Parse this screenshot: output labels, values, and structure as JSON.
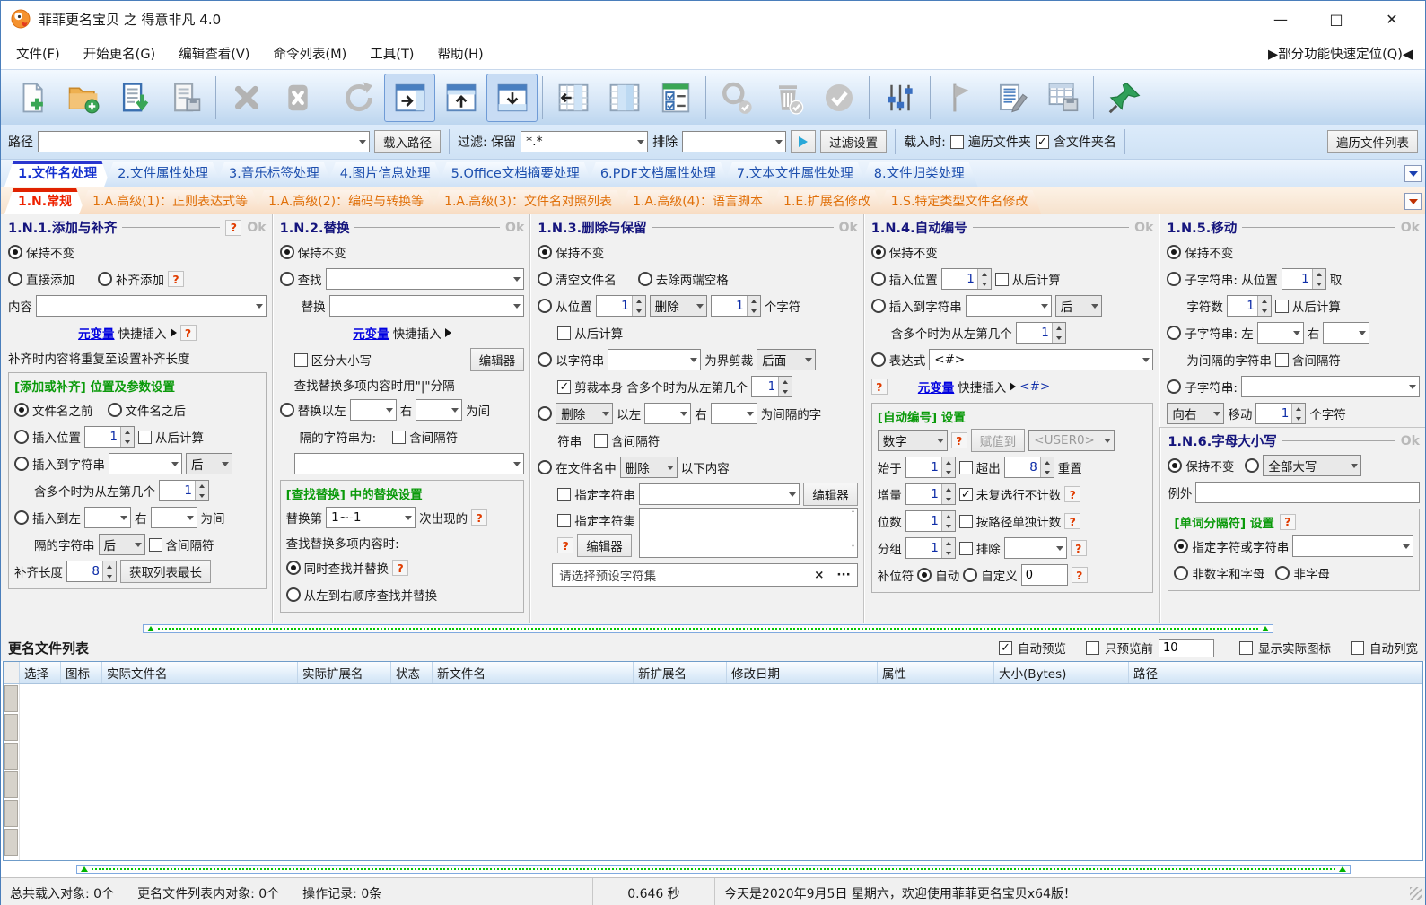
{
  "window": {
    "title": "菲菲更名宝贝 之 得意非凡 4.0",
    "minimize": "—",
    "maximize": "□",
    "close": "✕"
  },
  "menu": {
    "items": [
      "文件(F)",
      "开始更名(G)",
      "编辑查看(V)",
      "命令列表(M)",
      "工具(T)",
      "帮助(H)"
    ],
    "quick_locate": "▶部分功能快速定位(Q)◀"
  },
  "toolbar": {
    "buttons": [
      "new-file",
      "add-folder",
      "import-list",
      "save-list",
      "delete",
      "delete-all",
      "refresh",
      "preview-pane-right",
      "preview-pane-top",
      "preview-pane-bottom",
      "columns-left",
      "columns-layout",
      "check-options",
      "search-check",
      "delete-filtered",
      "apply-check",
      "adjust-settings",
      "flag-mark",
      "edit-list",
      "table-save",
      "pin-window"
    ]
  },
  "pathbar": {
    "path_label": "路径",
    "load_path": "载入路径",
    "filter_label": "过滤: 保留",
    "filter_value": "*.*",
    "exclude_label": "排除",
    "filter_settings": "过滤设置",
    "load_when": "载入时:",
    "traverse_folders": "遍历文件夹",
    "include_folder_name": "含文件夹名",
    "traverse_list": "遍历文件列表"
  },
  "tabs1": [
    "1.文件名处理",
    "2.文件属性处理",
    "3.音乐标签处理",
    "4.图片信息处理",
    "5.Office文档摘要处理",
    "6.PDF文档属性处理",
    "7.文本文件属性处理",
    "8.文件归类处理"
  ],
  "tabs2": [
    "1.N.常规",
    "1.A.高级(1)：正则表达式等",
    "1.A.高级(2)：编码与转换等",
    "1.A.高级(3)：文件名对照列表",
    "1.A.高级(4)：语言脚本",
    "1.E.扩展名修改",
    "1.S.特定类型文件名修改"
  ],
  "ui": {
    "ok": "Ok",
    "help": "?",
    "right": "右",
    "back": "后"
  },
  "colors": {
    "accent_blue": "#2a36cf",
    "accent_red": "#e02200",
    "tab_orange": "#e0700a",
    "link_blue": "#0000e0",
    "green_label": "#0a9a0a",
    "splitter_green": "#00c800"
  },
  "p1": {
    "title": "1.N.1.添加与补齐",
    "keep": "保持不变",
    "direct": "直接添加",
    "pad": "补齐添加",
    "content": "内容",
    "var_link": "元变量",
    "var_tail": "快捷插入",
    "note": "补齐时内容将重复至设置补齐长度",
    "grp": "[添加或补齐] 位置及参数设置",
    "before": "文件名之前",
    "after": "文件名之后",
    "ins_pos": "插入位置",
    "pos_val": "1",
    "calc_end": "从后计算",
    "ins_str": "插入到字符串",
    "multi": "含多个时为从左第几个",
    "multi_val": "1",
    "ins_left": "插入到左",
    "wei_jian": "为间",
    "sep_str": "隔的字符串",
    "incl_sep": "含间隔符",
    "pad_len": "补齐长度",
    "pad_val": "8",
    "get_max": "获取列表最长"
  },
  "p2": {
    "title": "1.N.2.替换",
    "keep": "保持不变",
    "find": "查找",
    "repl": "替换",
    "var_link": "元变量",
    "var_tail": "快捷插入",
    "case": "区分大小写",
    "editor": "编辑器",
    "note": "查找替换多项内容时用\"|\"分隔",
    "rep_left": "替换以左",
    "wei_jian": "为间",
    "sep_str2": "隔的字符串为:",
    "incl_sep": "含间隔符",
    "grp": "[查找替换] 中的替换设置",
    "times_label": "替换第",
    "times_val": "1~-1",
    "times_tail": "次出现的",
    "multi_note": "查找替换多项内容时:",
    "simul": "同时查找并替换",
    "seq": "从左到右顺序查找并替换"
  },
  "p3": {
    "title": "1.N.3.删除与保留",
    "keep": "保持不变",
    "clear": "清空文件名",
    "trim": "去除两端空格",
    "from_pos": "从位置",
    "pos_val": "1",
    "del": "删除",
    "count_val": "1",
    "chars": "个字符",
    "calc_end": "从后计算",
    "by_str": "以字符串",
    "cut": "为界剪裁",
    "cut_side": "后面",
    "cut_self": "剪裁本身",
    "multi": "含多个时为从左第几个",
    "multi_val": "1",
    "left": "以左",
    "sep_tail": "为间隔的字",
    "sep_tail2": "符串",
    "incl_sep": "含间隔符",
    "in_name": "在文件名中",
    "following": "以下内容",
    "spec_str": "指定字符串",
    "editor": "编辑器",
    "spec_set": "指定字符集",
    "preset": "请选择预设字符集",
    "clear_x": "×",
    "more": "···"
  },
  "p4": {
    "title": "1.N.4.自动编号",
    "keep": "保持不变",
    "ins_pos": "插入位置",
    "pos_val": "1",
    "calc_end": "从后计算",
    "ins_str": "插入到字符串",
    "multi": "含多个时为从左第几个",
    "multi_val": "1",
    "expr": "表达式",
    "expr_val": "<#>",
    "var_link": "元变量",
    "var_tail": "快捷插入",
    "expr_tag": "<#>",
    "grp": "[自动编号] 设置",
    "num_type": "数字",
    "assign": "赋值到",
    "user_var": "<USER0>",
    "start": "始于",
    "start_val": "1",
    "over": "超出",
    "over_val": "8",
    "reset": "重置",
    "inc": "增量",
    "inc_val": "1",
    "no_count": "未复选行不计数",
    "digits": "位数",
    "digits_val": "1",
    "per_path": "按路径单独计数",
    "group": "分组",
    "group_val": "1",
    "exclude": "排除",
    "pad_char": "补位符",
    "auto": "自动",
    "custom": "自定义",
    "custom_val": "0"
  },
  "p5": {
    "title": "1.N.5.移动",
    "keep": "保持不变",
    "sub1": "子字符串: 从位置",
    "pos_val": "1",
    "qu": "取",
    "chars": "字符数",
    "chars_val": "1",
    "calc_end": "从后计算",
    "sub2": "子字符串: 左",
    "sep_tail": "为间隔的字符串",
    "incl_sep": "含间隔符",
    "sub3": "子字符串:",
    "dir": "向右",
    "move": "移动",
    "move_val": "1",
    "unit": "个字符"
  },
  "p6": {
    "title": "1.N.6.字母大小写",
    "keep": "保持不变",
    "case_val": "全部大写",
    "except": "例外",
    "grp": "[单词分隔符] 设置",
    "spec": "指定字符或字符串",
    "non_alnum": "非数字和字母",
    "non_alpha": "非字母"
  },
  "list": {
    "title": "更名文件列表",
    "auto_preview": "自动预览",
    "preview_first": "只预览前",
    "preview_count": "10",
    "show_icons": "显示实际图标",
    "auto_width": "自动列宽",
    "columns": [
      "选择",
      "图标",
      "实际文件名",
      "实际扩展名",
      "状态",
      "新文件名",
      "新扩展名",
      "修改日期",
      "属性",
      "大小(Bytes)",
      "路径"
    ]
  },
  "status": {
    "loaded": "总共载入对象: 0个",
    "in_list": "更名文件列表内对象: 0个",
    "ops": "操作记录: 0条",
    "time": "0.646 秒",
    "welcome": "今天是2020年9月5日 星期六，欢迎使用菲菲更名宝贝x64版！"
  }
}
